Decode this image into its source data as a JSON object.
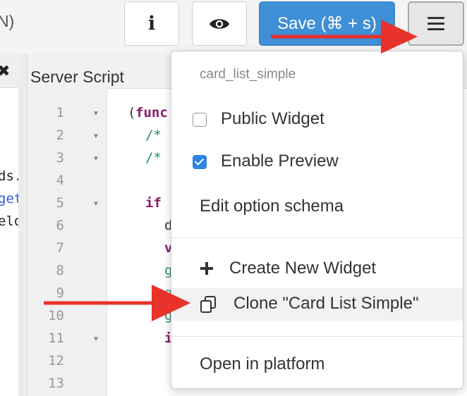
{
  "toolbar": {
    "partial_text": "N)",
    "info_icon": "info-icon",
    "eye_icon": "eye-icon",
    "save_label": "Save (⌘ + s)",
    "menu_icon": "hamburger-menu-icon"
  },
  "left_panel": {
    "close_symbol": "✖",
    "fragments": [
      {
        "text": "ds.",
        "color": "#222222"
      },
      {
        "text": "get",
        "color": "#2b5bd8"
      },
      {
        "text": "elo",
        "color": "#222222"
      }
    ]
  },
  "script_panel": {
    "title": "Server Script",
    "line_numbers": [
      "1",
      "2",
      "3",
      "4",
      "5",
      "6",
      "7",
      "8",
      "9",
      "10",
      "11",
      "12",
      "13"
    ],
    "fold_markers": [
      1,
      2,
      3,
      5,
      11
    ],
    "code_fragments": [
      {
        "text": "(",
        "color": "#333333"
      },
      {
        "text": "func",
        "color": "#8b1a6b"
      },
      {
        "text": "/*",
        "color": "#2a8a6e"
      },
      {
        "text": "/*",
        "color": "#2a8a6e"
      },
      {
        "text": "if",
        "color": "#8b1a6b"
      },
      {
        "text": "d",
        "color": "#333333"
      },
      {
        "text": "v",
        "color": "#8b1a6b"
      },
      {
        "text": "g",
        "color": "#2a8a6e"
      },
      {
        "text": "g",
        "color": "#2a8a6e"
      },
      {
        "text": "g",
        "color": "#2a8a6e"
      },
      {
        "text": "i",
        "color": "#8b1a6b"
      }
    ]
  },
  "menu": {
    "header": "card_list_simple",
    "public_widget": {
      "label": "Public Widget",
      "checked": false
    },
    "enable_preview": {
      "label": "Enable Preview",
      "checked": true
    },
    "edit_schema": "Edit option schema",
    "create_new": {
      "icon": "plus-icon",
      "label": "Create New Widget"
    },
    "clone": {
      "icon": "clone-icon",
      "label": "Clone \"Card List Simple\""
    },
    "open_platform": "Open in platform"
  },
  "colors": {
    "save_button": "#3f8fd6",
    "checkbox_checked": "#2d84e2",
    "annotation_arrow": "#e8322a"
  }
}
